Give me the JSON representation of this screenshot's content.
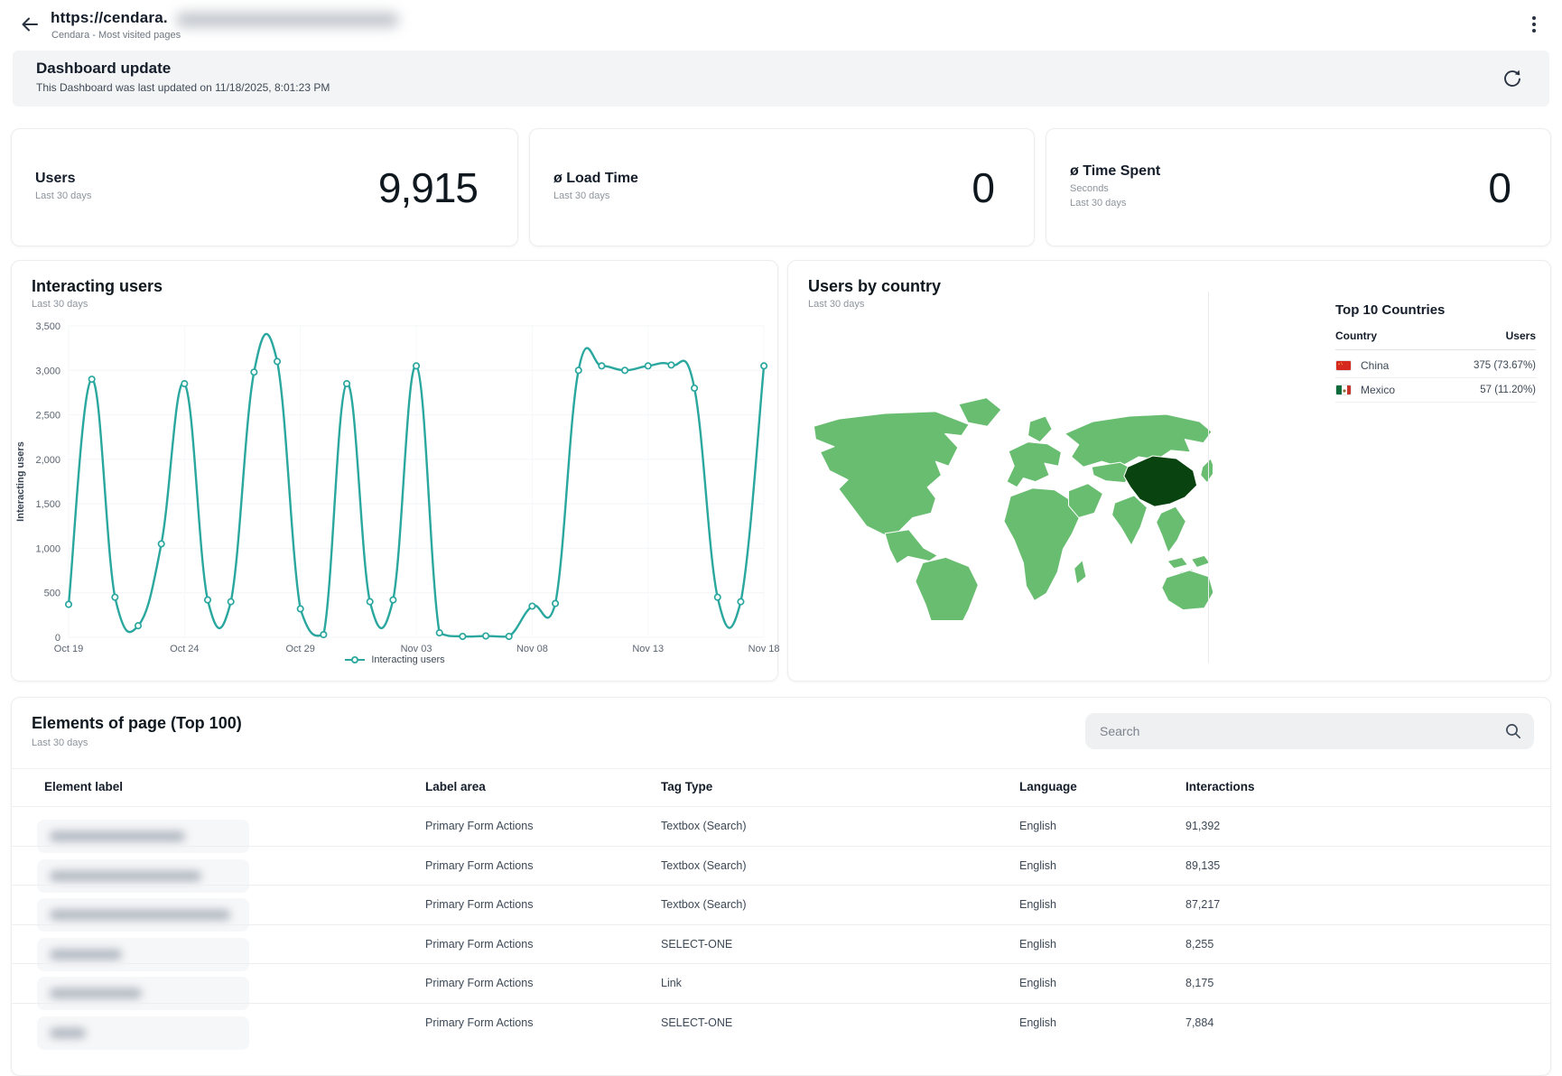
{
  "browser": {
    "url_prefix": "https://cendara.",
    "page_subtitle": "Cendara - Most visited pages"
  },
  "banner": {
    "title": "Dashboard update",
    "subtitle": "This Dashboard was last updated on 11/18/2025, 8:01:23 PM"
  },
  "kpis": [
    {
      "title": "Users",
      "period": "Last 30 days",
      "value": "9,915"
    },
    {
      "title": "ø Load Time",
      "period": "Last 30 days",
      "value": "0"
    },
    {
      "title": "ø Time Spent",
      "unit": "Seconds",
      "period": "Last 30 days",
      "value": "0"
    }
  ],
  "chart_data": {
    "type": "line",
    "title": "Interacting users",
    "period": "Last 30 days",
    "ylabel": "Interacting users",
    "legend": [
      "Interacting users"
    ],
    "color": "#2aa79e",
    "ylim": [
      0,
      3500
    ],
    "ytick_step": 500,
    "xtick_labels": [
      "Oct 19",
      "Oct 24",
      "Oct 29",
      "Nov 03",
      "Nov 08",
      "Nov 13",
      "Nov 18"
    ],
    "x": [
      "Oct 19",
      "Oct 20",
      "Oct 21",
      "Oct 22",
      "Oct 23",
      "Oct 24",
      "Oct 25",
      "Oct 26",
      "Oct 27",
      "Oct 28",
      "Oct 29",
      "Oct 30",
      "Oct 31",
      "Nov 01",
      "Nov 02",
      "Nov 03",
      "Nov 04",
      "Nov 05",
      "Nov 06",
      "Nov 07",
      "Nov 08",
      "Nov 09",
      "Nov 10",
      "Nov 11",
      "Nov 12",
      "Nov 13",
      "Nov 14",
      "Nov 15",
      "Nov 16",
      "Nov 17",
      "Nov 18"
    ],
    "values": [
      370,
      2900,
      450,
      130,
      1050,
      2850,
      420,
      400,
      2980,
      3100,
      320,
      30,
      2850,
      400,
      420,
      3050,
      50,
      10,
      15,
      10,
      350,
      380,
      3000,
      3050,
      3000,
      3050,
      3060,
      2800,
      450,
      400,
      3050
    ],
    "grid": true,
    "legend_position": "bottom"
  },
  "map": {
    "title": "Users by country",
    "period": "Last 30 days",
    "colors": {
      "country": "#68bd70",
      "top_country": "#09430f"
    },
    "top_countries": {
      "title": "Top 10 Countries",
      "col_country": "Country",
      "col_users": "Users",
      "rows": [
        {
          "country": "China",
          "users": "375 (73.67%)"
        },
        {
          "country": "Mexico",
          "users": "57 (11.20%)"
        }
      ]
    }
  },
  "table": {
    "title": "Elements of page (Top 100)",
    "period": "Last 30 days",
    "search_placeholder": "Search",
    "columns": [
      "Element label",
      "Label area",
      "Tag Type",
      "Language",
      "Interactions"
    ],
    "rows": [
      {
        "label_redacted": true,
        "label_blur_width": 150,
        "label_area": "Primary Form Actions",
        "tag_type": "Textbox (Search)",
        "language": "English",
        "interactions": "91,392"
      },
      {
        "label_redacted": true,
        "label_blur_width": 168,
        "label_area": "Primary Form Actions",
        "tag_type": "Textbox (Search)",
        "language": "English",
        "interactions": "89,135"
      },
      {
        "label_redacted": true,
        "label_blur_width": 200,
        "label_area": "Primary Form Actions",
        "tag_type": "Textbox (Search)",
        "language": "English",
        "interactions": "87,217"
      },
      {
        "label_redacted": true,
        "label_blur_width": 80,
        "label_area": "Primary Form Actions",
        "tag_type": "SELECT-ONE",
        "language": "English",
        "interactions": "8,255"
      },
      {
        "label_redacted": true,
        "label_blur_width": 102,
        "label_area": "Primary Form Actions",
        "tag_type": "Link",
        "language": "English",
        "interactions": "8,175"
      },
      {
        "label_redacted": true,
        "label_blur_width": 40,
        "label_area": "Primary Form Actions",
        "tag_type": "SELECT-ONE",
        "language": "English",
        "interactions": "7,884"
      }
    ]
  }
}
